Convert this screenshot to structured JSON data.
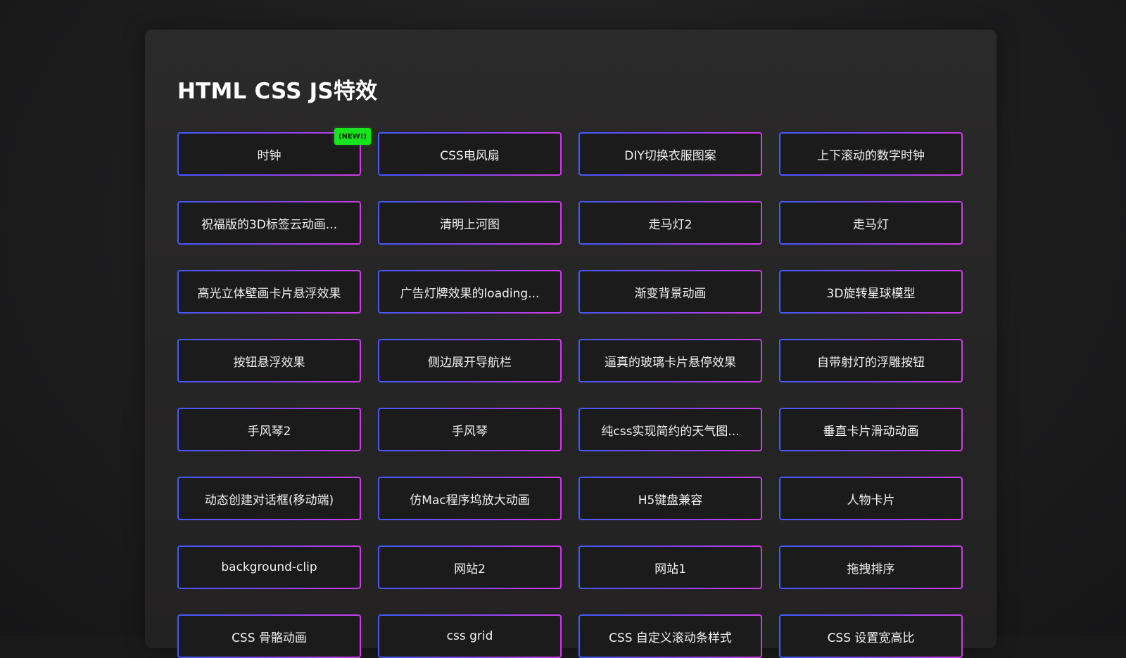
{
  "page": {
    "title": "HTML CSS JS特效"
  },
  "badge": {
    "new_label": "(NEW!)",
    "color": "#19e31f"
  },
  "colors": {
    "border_start": "#3f5bff",
    "border_end": "#d33be6",
    "card_bg": "#1b1b1c",
    "page_bg": "#1a1a1b",
    "text": "#f2f2f2"
  },
  "items": [
    {
      "label": "时钟",
      "is_new": true
    },
    {
      "label": "CSS电风扇"
    },
    {
      "label": "DIY切换衣服图案"
    },
    {
      "label": "上下滚动的数字时钟"
    },
    {
      "label": "祝福版的3D标签云动画..."
    },
    {
      "label": "清明上河图"
    },
    {
      "label": "走马灯2"
    },
    {
      "label": "走马灯"
    },
    {
      "label": "高光立体壁画卡片悬浮效果"
    },
    {
      "label": "广告灯牌效果的loading..."
    },
    {
      "label": "渐变背景动画"
    },
    {
      "label": "3D旋转星球模型"
    },
    {
      "label": "按钮悬浮效果"
    },
    {
      "label": "侧边展开导航栏"
    },
    {
      "label": "逼真的玻璃卡片悬停效果"
    },
    {
      "label": "自带射灯的浮雕按钮"
    },
    {
      "label": "手风琴2"
    },
    {
      "label": "手风琴"
    },
    {
      "label": "纯css实现简约的天气图..."
    },
    {
      "label": "垂直卡片滑动动画"
    },
    {
      "label": "动态创建对话框(移动端)"
    },
    {
      "label": "仿Mac程序坞放大动画"
    },
    {
      "label": "H5键盘兼容"
    },
    {
      "label": "人物卡片"
    },
    {
      "label": "background-clip"
    },
    {
      "label": "网站2"
    },
    {
      "label": "网站1"
    },
    {
      "label": "拖拽排序"
    },
    {
      "label": "CSS 骨骼动画"
    },
    {
      "label": "css grid"
    },
    {
      "label": "CSS 自定义滚动条样式"
    },
    {
      "label": "CSS 设置宽高比"
    }
  ]
}
